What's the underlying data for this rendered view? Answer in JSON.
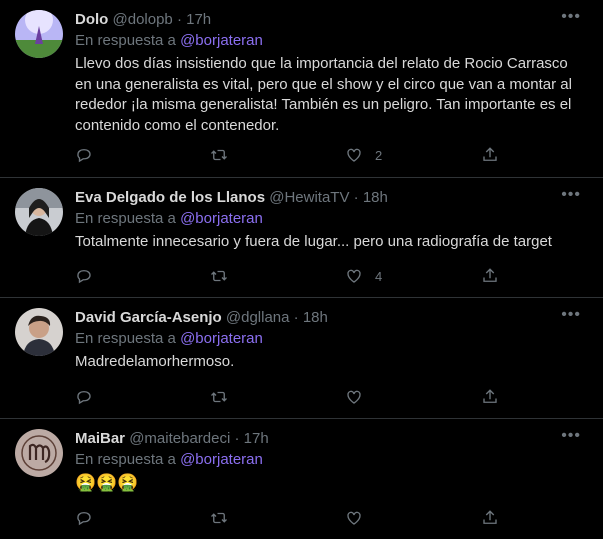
{
  "reply_prefix": "En respuesta a",
  "tweets": [
    {
      "name": "Dolo",
      "handle": "@dolopb",
      "time": "17h",
      "reply_to": "@borjateran",
      "text": "Llevo dos días insistiendo que la importancia del relato de Rocio Carrasco en una generalista es vital, pero que el show y el circo que van a montar al rededor ¡la misma generalista! También es un peligro. Tan importante es el contenido como el contenedor.",
      "likes": "2",
      "retweets": ""
    },
    {
      "name": "Eva Delgado de los Llanos",
      "handle": "@HewitaTV",
      "time": "18h",
      "reply_to": "@borjateran",
      "text": "Totalmente innecesario y fuera de lugar... pero una radiografía de target",
      "likes": "4",
      "retweets": ""
    },
    {
      "name": "David García-Asenjo",
      "handle": "@dgllana",
      "time": "18h",
      "reply_to": "@borjateran",
      "text": "Madredelamorhermoso.",
      "likes": "",
      "retweets": ""
    },
    {
      "name": "MaiBar",
      "handle": "@maitebardeci",
      "time": "17h",
      "reply_to": "@borjateran",
      "text": "🤮🤮🤮",
      "likes": "",
      "retweets": ""
    }
  ],
  "icons": {
    "reply": "reply-icon",
    "retweet": "retweet-icon",
    "like": "like-icon",
    "share": "share-icon",
    "more": "more-icon"
  },
  "colors": {
    "background": "#000000",
    "text": "#d9d9d9",
    "muted": "#6e767d",
    "mention": "#8b6ff0",
    "divider": "#2f3336"
  }
}
